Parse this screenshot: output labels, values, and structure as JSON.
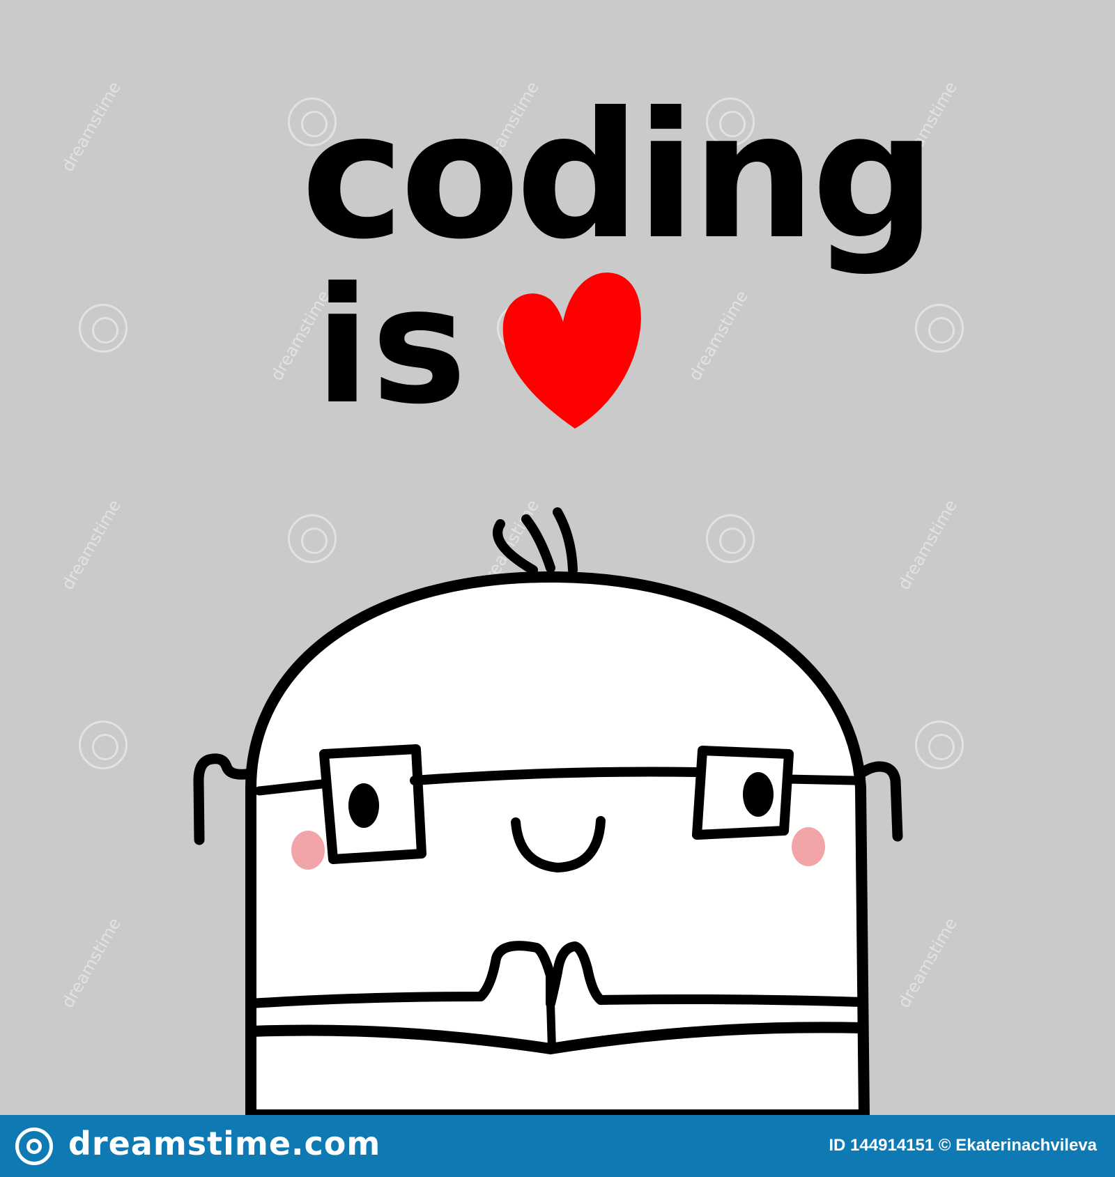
{
  "lettering": {
    "line1": "coding",
    "line2": "is"
  },
  "watermark": {
    "text": "dreamstime"
  },
  "footer": {
    "site": "dreamstime.com",
    "credit": "ID 144914151 © Ekaterinachvileva"
  },
  "colors": {
    "background": "#cacaca",
    "heart": "#ff0000",
    "cheeks": "#f2a5a8",
    "ink": "#000000",
    "footer_bar": "#0f79b4"
  }
}
